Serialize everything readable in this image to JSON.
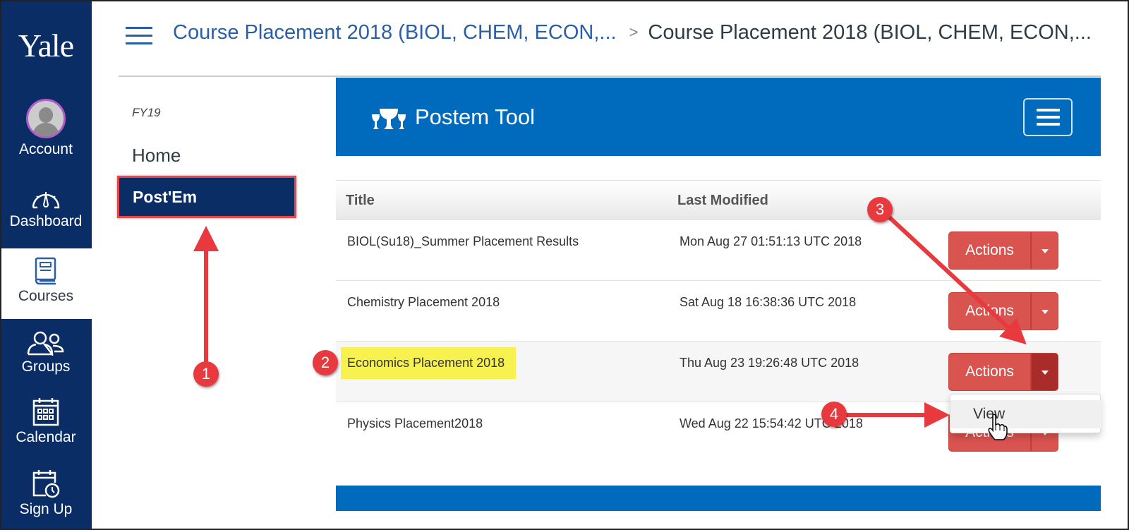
{
  "global_nav": {
    "logo": "Yale",
    "items": [
      {
        "label": "Account",
        "icon": "avatar-icon"
      },
      {
        "label": "Dashboard",
        "icon": "gauge-icon"
      },
      {
        "label": "Courses",
        "icon": "book-icon",
        "active": true
      },
      {
        "label": "Groups",
        "icon": "users-icon"
      },
      {
        "label": "Calendar",
        "icon": "calendar-icon"
      },
      {
        "label": "Sign Up",
        "icon": "calendar-clock-icon"
      }
    ]
  },
  "header": {
    "breadcrumb": {
      "link": "Course Placement 2018 (BIOL, CHEM, ECON,...",
      "separator": ">",
      "current": "Course Placement 2018 (BIOL, CHEM, ECON,..."
    }
  },
  "course_nav": {
    "term": "FY19",
    "items": [
      {
        "label": "Home"
      },
      {
        "label": "Post'Em",
        "active": true
      }
    ]
  },
  "tool": {
    "title": "Postem Tool",
    "table": {
      "columns": [
        "Title",
        "Last Modified"
      ],
      "rows": [
        {
          "title": "BIOL(Su18)_Summer Placement Results",
          "modified": "Mon Aug 27 01:51:13 UTC 2018",
          "action": "Actions"
        },
        {
          "title": "Chemistry Placement 2018",
          "modified": "Sat Aug 18 16:38:36 UTC 2018",
          "action": "Actions"
        },
        {
          "title": "Economics Placement 2018",
          "modified": "Thu Aug 23 19:26:48 UTC 2018",
          "action": "Actions",
          "highlighted": true,
          "dropdown_open": true
        },
        {
          "title": "Physics Placement2018",
          "modified": "Wed Aug 22 15:54:42 UTC 2018",
          "action": "Actions"
        }
      ]
    },
    "dropdown": {
      "items": [
        "View"
      ]
    }
  },
  "annotations": {
    "steps": [
      "1",
      "2",
      "3",
      "4"
    ],
    "color": "#e8393f"
  },
  "colors": {
    "nav_bg": "#0a2d66",
    "tool_blue": "#006bbd",
    "action_red": "#d9534f",
    "highlight": "#f7f24f",
    "link_blue": "#2a5fa6"
  }
}
